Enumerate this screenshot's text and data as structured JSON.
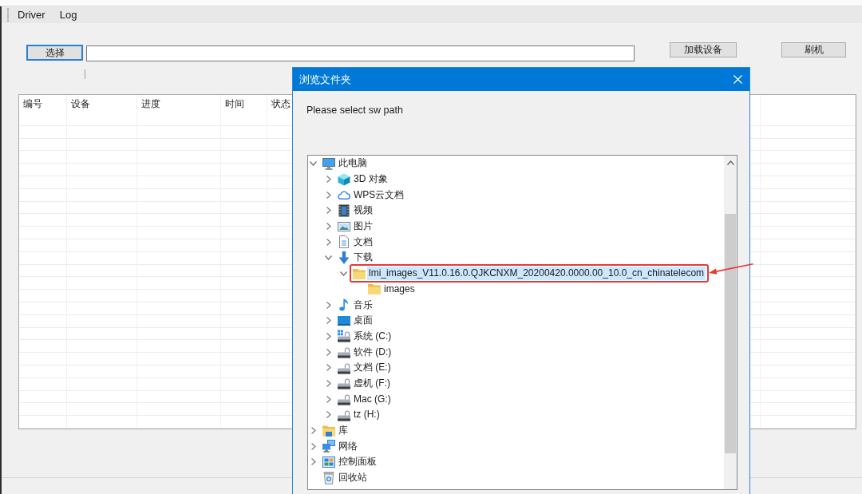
{
  "menu": [
    {
      "label": "Driver"
    },
    {
      "label": "Log"
    }
  ],
  "toolbar": {
    "select_button": {
      "label": "选择",
      "focused": true
    },
    "load_button": "加载设备",
    "flash_button": "刷机"
  },
  "table": {
    "columns": [
      "编号",
      "设备",
      "进度",
      "时间",
      "状态"
    ]
  },
  "dialog": {
    "title": "浏览文件夹",
    "prompt": "Please select sw path",
    "tree": [
      {
        "label": "此电脑",
        "kind": "computer",
        "expanded": true,
        "selected": false,
        "annotated": false,
        "children": [
          {
            "label": "3D 对象",
            "kind": "cube",
            "expanded": false,
            "selected": false,
            "annotated": false
          },
          {
            "label": "WPS云文档",
            "kind": "cloud",
            "expanded": false,
            "selected": false,
            "annotated": false
          },
          {
            "label": "视频",
            "kind": "film",
            "expanded": false,
            "selected": false,
            "annotated": false
          },
          {
            "label": "图片",
            "kind": "picture",
            "expanded": false,
            "selected": false,
            "annotated": false
          },
          {
            "label": "文档",
            "kind": "document",
            "expanded": false,
            "selected": false,
            "annotated": false
          },
          {
            "label": "下载",
            "kind": "download",
            "expanded": true,
            "selected": false,
            "annotated": false,
            "children": [
              {
                "label": "lmi_images_V11.0.16.0.QJKCNXM_20200420.0000.00_10.0_cn_chinatelecom",
                "kind": "folder",
                "expanded": true,
                "selected": true,
                "annotated": true,
                "children": [
                  {
                    "label": "images",
                    "kind": "folder",
                    "selected": false,
                    "annotated": false
                  }
                ]
              }
            ]
          },
          {
            "label": "音乐",
            "kind": "music",
            "expanded": false,
            "selected": false,
            "annotated": false
          },
          {
            "label": "桌面",
            "kind": "desktop",
            "expanded": false,
            "selected": false,
            "annotated": false
          },
          {
            "label": "系统 (C:)",
            "kind": "system-drive",
            "expanded": false,
            "selected": false,
            "annotated": false
          },
          {
            "label": "软件 (D:)",
            "kind": "drive",
            "expanded": false,
            "selected": false,
            "annotated": false
          },
          {
            "label": "文档 (E:)",
            "kind": "drive",
            "expanded": false,
            "selected": false,
            "annotated": false
          },
          {
            "label": "虚机 (F:)",
            "kind": "drive",
            "expanded": false,
            "selected": false,
            "annotated": false
          },
          {
            "label": "Mac (G:)",
            "kind": "drive",
            "expanded": false,
            "selected": false,
            "annotated": false
          },
          {
            "label": "tz (H:)",
            "kind": "drive",
            "expanded": false,
            "selected": false,
            "annotated": false
          }
        ]
      },
      {
        "label": "库",
        "kind": "library",
        "expanded": false,
        "selected": false,
        "annotated": false
      },
      {
        "label": "网络",
        "kind": "network",
        "expanded": false,
        "selected": false,
        "annotated": false
      },
      {
        "label": "控制面板",
        "kind": "control-panel",
        "expanded": false,
        "selected": false,
        "annotated": false
      },
      {
        "label": "回收站",
        "kind": "recycle-bin",
        "selected": false,
        "annotated": false
      }
    ]
  }
}
